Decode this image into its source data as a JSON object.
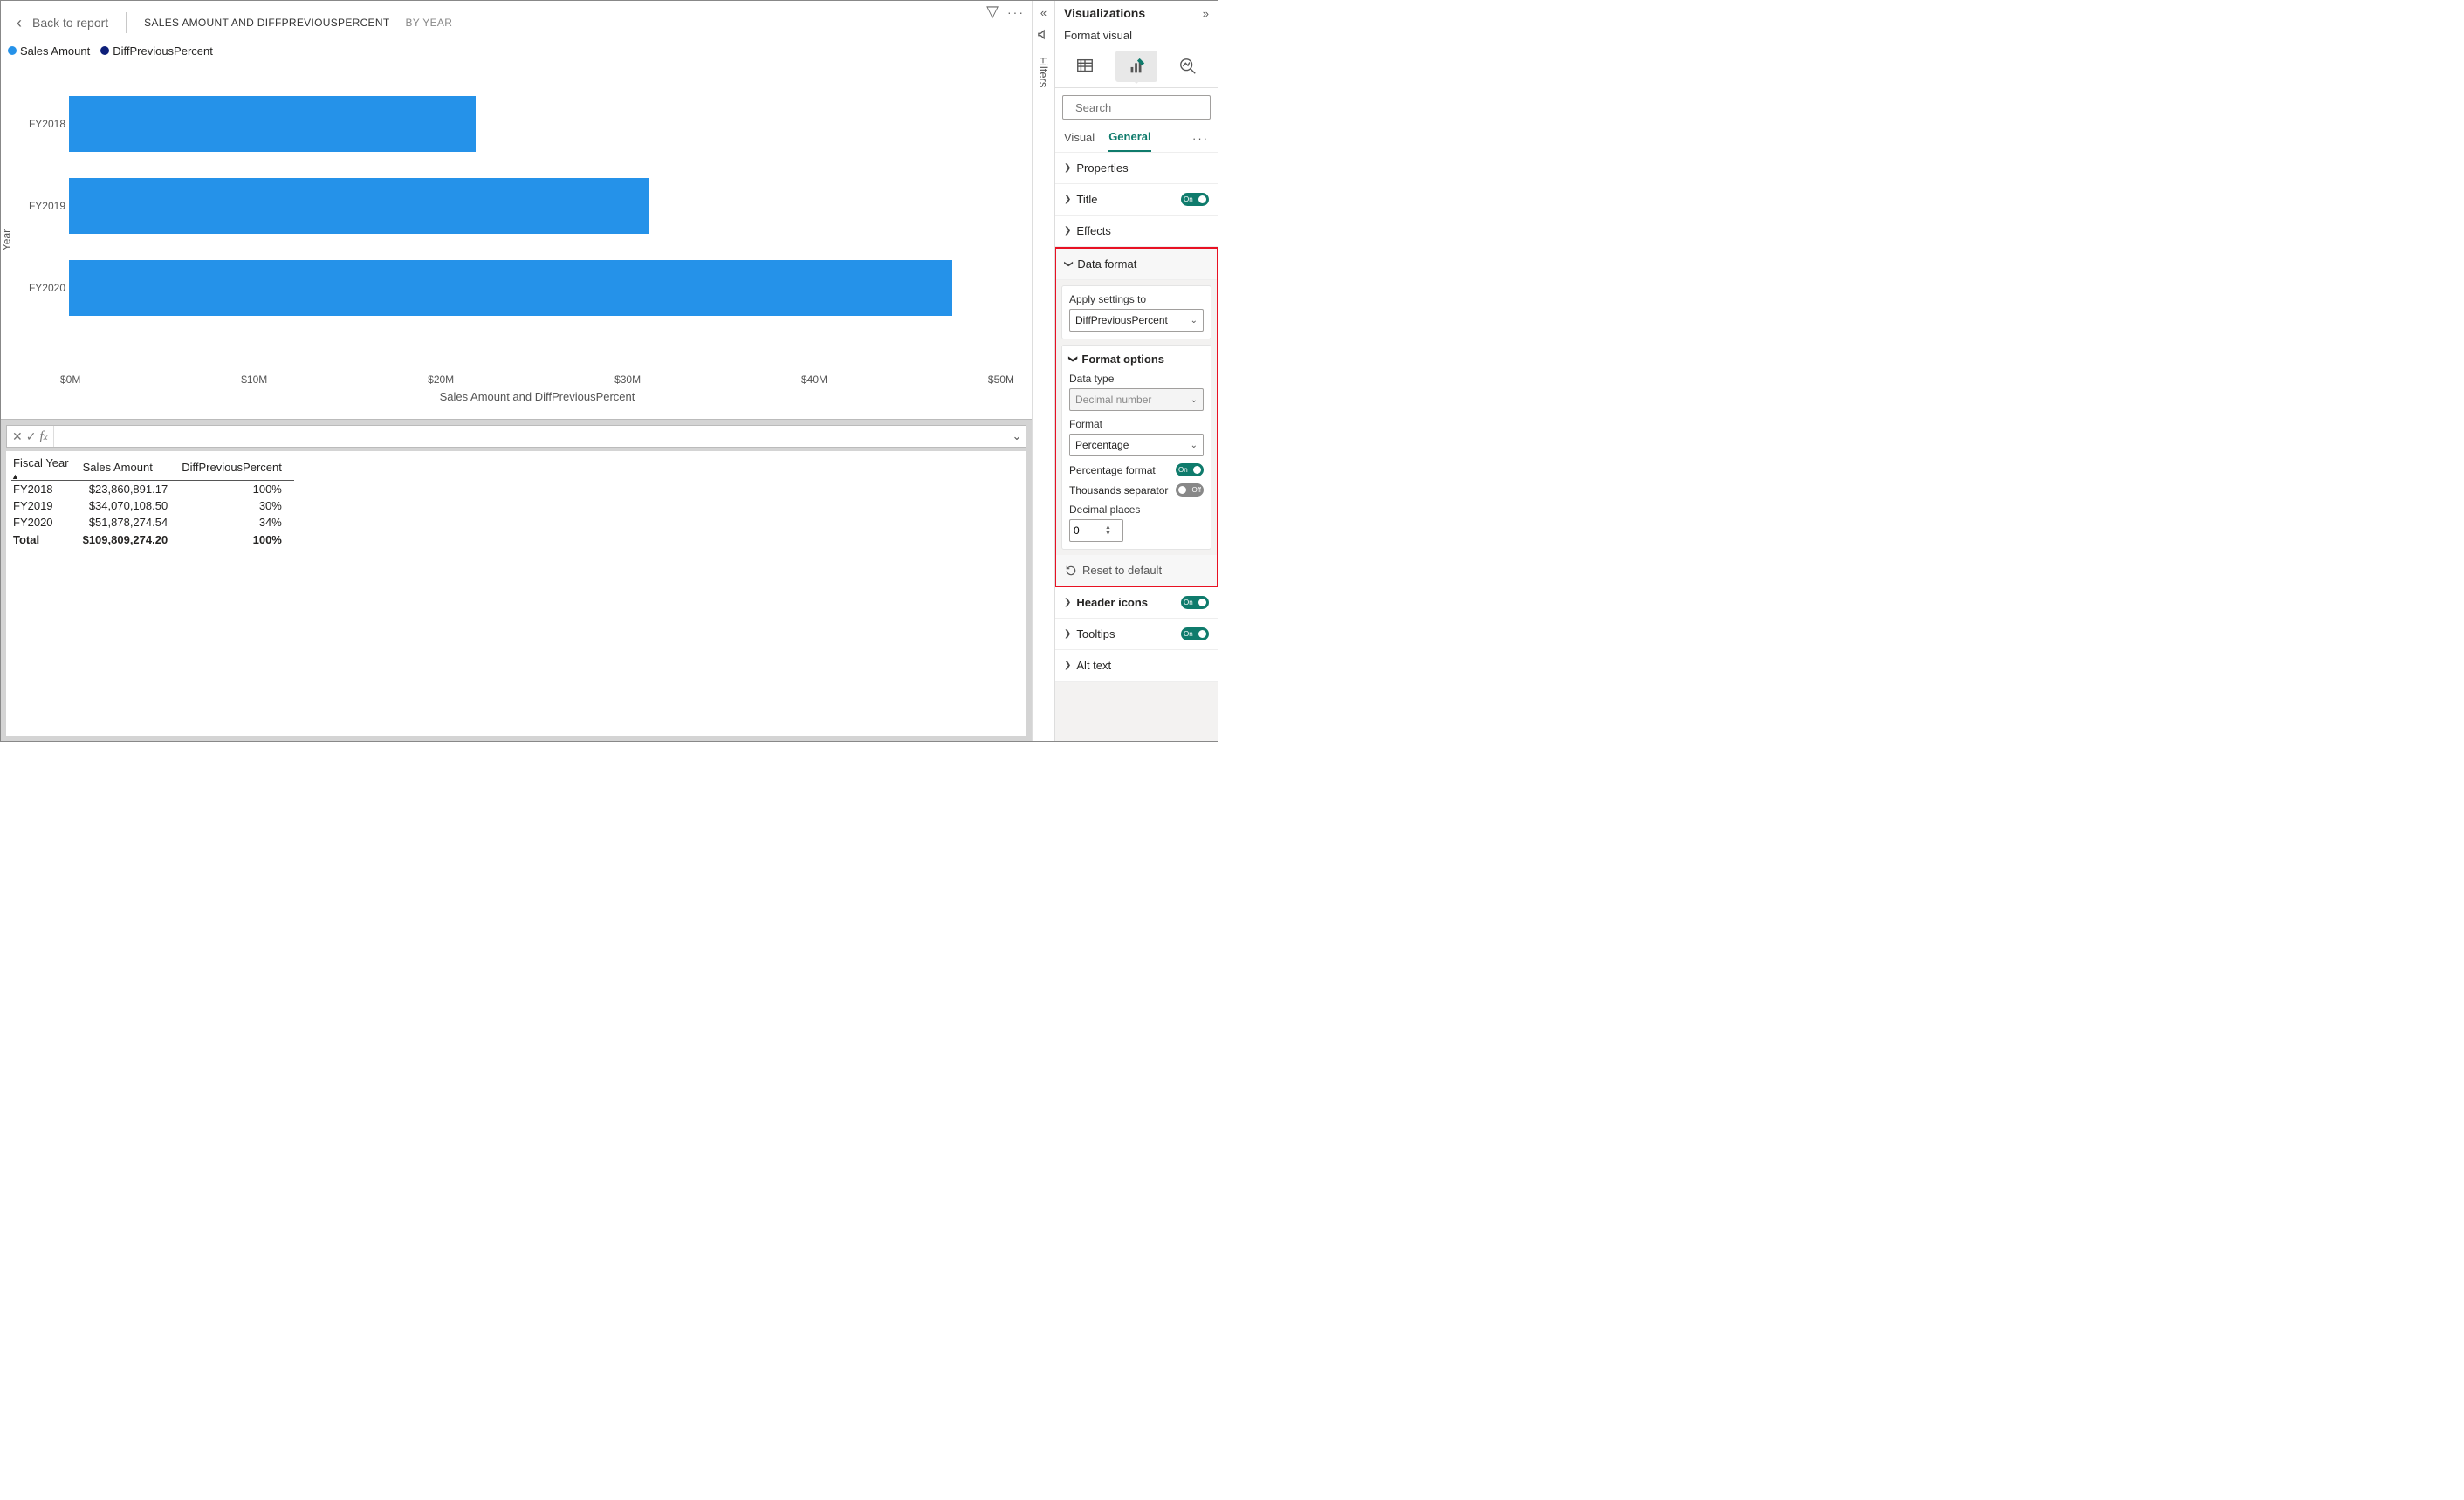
{
  "header": {
    "back": "Back to report",
    "title": "SALES AMOUNT AND DIFFPREVIOUSPERCENT",
    "subtitle": "BY YEAR"
  },
  "legend": {
    "series1": {
      "label": "Sales Amount",
      "color": "#2592e9"
    },
    "series2": {
      "label": "DiffPreviousPercent",
      "color": "#0d1f7a"
    }
  },
  "chart_data": {
    "type": "bar",
    "orientation": "horizontal",
    "categories": [
      "FY2018",
      "FY2019",
      "FY2020"
    ],
    "series": [
      {
        "name": "Sales Amount",
        "values": [
          23860891.17,
          34070108.5,
          51878274.54
        ]
      }
    ],
    "xlabel": "Sales Amount and DiffPreviousPercent",
    "ylabel": "Year",
    "xlim": [
      0,
      55000000
    ],
    "xticks": [
      "$0M",
      "$10M",
      "$20M",
      "$30M",
      "$40M",
      "$50M"
    ]
  },
  "table": {
    "headers": [
      "Fiscal Year",
      "Sales Amount",
      "DiffPreviousPercent"
    ],
    "rows": [
      [
        "FY2018",
        "$23,860,891.17",
        "100%"
      ],
      [
        "FY2019",
        "$34,070,108.50",
        "30%"
      ],
      [
        "FY2020",
        "$51,878,274.54",
        "34%"
      ]
    ],
    "total": [
      "Total",
      "$109,809,274.20",
      "100%"
    ]
  },
  "filters": {
    "label": "Filters"
  },
  "viz": {
    "title": "Visualizations",
    "subtitle": "Format visual",
    "search_placeholder": "Search",
    "tabs": {
      "visual": "Visual",
      "general": "General"
    },
    "sections": {
      "properties": "Properties",
      "title": "Title",
      "effects": "Effects",
      "data_format": "Data format",
      "header_icons": "Header icons",
      "tooltips": "Tooltips",
      "alt_text": "Alt text"
    },
    "apply_settings_label": "Apply settings to",
    "apply_settings_value": "DiffPreviousPercent",
    "format_options": "Format options",
    "data_type_label": "Data type",
    "data_type_value": "Decimal number",
    "format_label": "Format",
    "format_value": "Percentage",
    "percentage_format": "Percentage format",
    "thousands_sep": "Thousands separator",
    "decimal_places_label": "Decimal places",
    "decimal_places_value": "0",
    "reset": "Reset to default"
  }
}
